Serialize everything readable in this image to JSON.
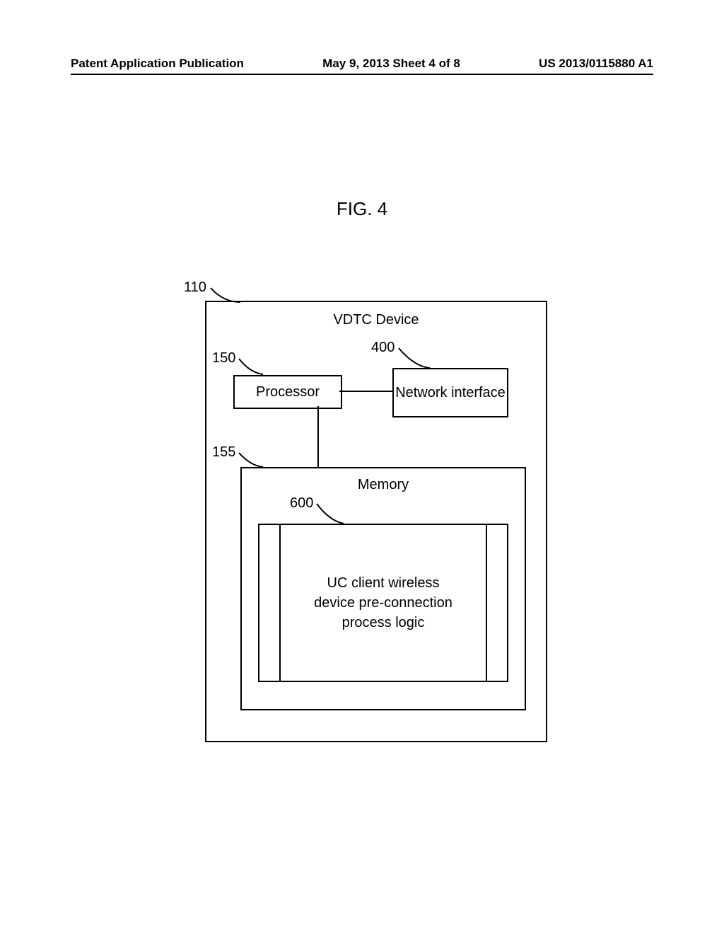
{
  "header": {
    "left": "Patent Application Publication",
    "center": "May 9, 2013  Sheet 4 of 8",
    "right": "US 2013/0115880 A1"
  },
  "figure_label": "FIG. 4",
  "refs": {
    "r110": "110",
    "r150": "150",
    "r400": "400",
    "r155": "155",
    "r600": "600"
  },
  "boxes": {
    "vdtc": "VDTC Device",
    "processor": "Processor",
    "network": "Network interface",
    "memory": "Memory",
    "logic_l1": "UC client wireless",
    "logic_l2": "device pre-connection",
    "logic_l3": "process logic"
  }
}
